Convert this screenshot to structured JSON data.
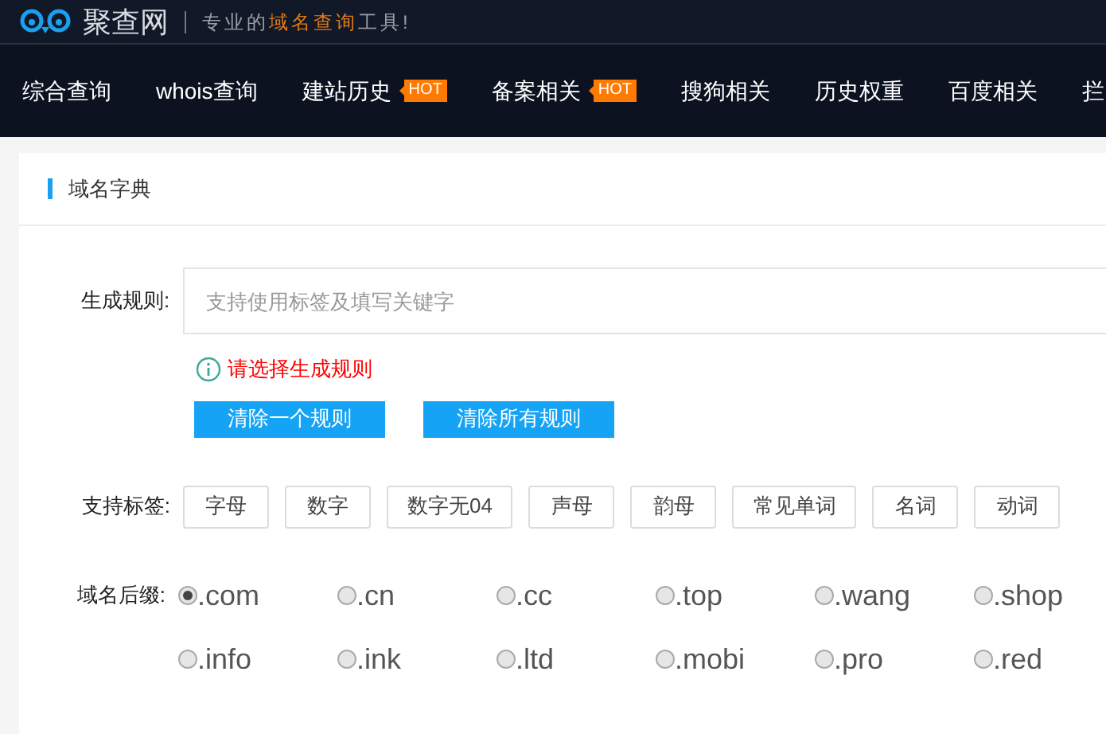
{
  "header": {
    "logo_text": "聚查网",
    "slogan": [
      {
        "text": "专业的",
        "highlight": false
      },
      {
        "text": "域名查询",
        "highlight": true
      },
      {
        "text": "工具!",
        "highlight": false
      }
    ]
  },
  "nav": [
    {
      "label": "综合查询"
    },
    {
      "label": "whois查询"
    },
    {
      "label": "建站历史",
      "badge": "HOT"
    },
    {
      "label": "备案相关",
      "badge": "HOT"
    },
    {
      "label": "搜狗相关"
    },
    {
      "label": "历史权重"
    },
    {
      "label": "百度相关"
    },
    {
      "label": "拦"
    }
  ],
  "panel": {
    "title": "域名字典",
    "rule": {
      "label": "生成规则:",
      "placeholder": "支持使用标签及填写关键字",
      "error": "请选择生成规则"
    },
    "buttons": [
      "清除一个规则",
      "清除所有规则"
    ],
    "tags": {
      "label": "支持标签:",
      "items": [
        "字母",
        "数字",
        "数字无04",
        "声母",
        "韵母",
        "常见单词",
        "名词",
        "动词"
      ]
    },
    "suffixes": {
      "label": "域名后缀:",
      "items": [
        {
          "label": ".com",
          "selected": true
        },
        {
          "label": ".cn",
          "selected": false
        },
        {
          "label": ".cc",
          "selected": false
        },
        {
          "label": ".top",
          "selected": false
        },
        {
          "label": ".wang",
          "selected": false
        },
        {
          "label": ".shop",
          "selected": false
        },
        {
          "label": ".info",
          "selected": false
        },
        {
          "label": ".ink",
          "selected": false
        },
        {
          "label": ".ltd",
          "selected": false
        },
        {
          "label": ".mobi",
          "selected": false
        },
        {
          "label": ".pro",
          "selected": false
        },
        {
          "label": ".red",
          "selected": false
        }
      ]
    }
  }
}
